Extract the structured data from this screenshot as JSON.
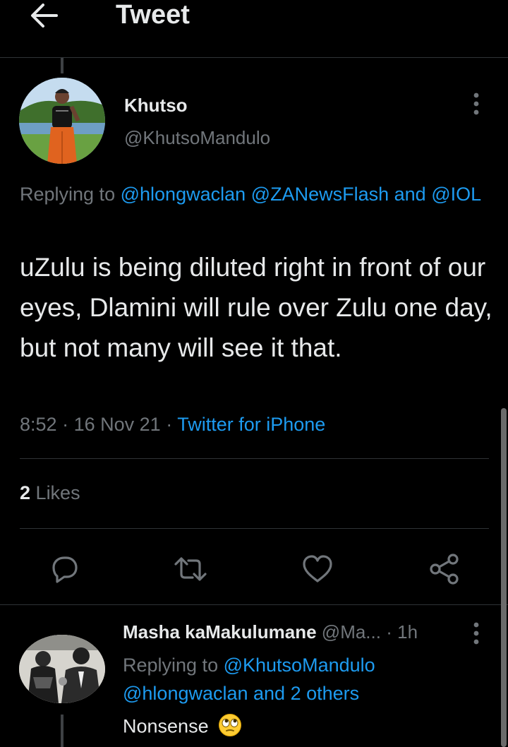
{
  "header": {
    "title": "Tweet",
    "back_icon": "arrow-left-icon"
  },
  "tweet": {
    "author_name": "Khutso",
    "author_handle": "@KhutsoMandulo",
    "replying_prefix": "Replying to",
    "replying_users": [
      "@hlongwaclan",
      "@ZANewsFlash"
    ],
    "replying_and": "and",
    "replying_last": "@IOL",
    "text": "uZulu is being diluted right in front of our eyes, Dlamini will rule over Zulu one day, but not many will see it that.",
    "time": "8:52",
    "date": "16 Nov 21",
    "dot": "·",
    "source": "Twitter for iPhone",
    "likes_count": "2",
    "likes_label": "Likes"
  },
  "actions": {
    "reply": "reply-icon",
    "retweet": "retweet-icon",
    "like": "heart-icon",
    "share": "share-icon"
  },
  "reply": {
    "name": "Masha kaMakulumane",
    "handle": "@Ma...",
    "time": "1h",
    "dot": "·",
    "replying_prefix": "Replying to",
    "replying_user": "@KhutsoMandulo",
    "replying_others": "@hlongwaclan and 2 others",
    "text": "Nonsense",
    "emoji": "face-with-rolling-eyes"
  },
  "colors": {
    "background": "#000000",
    "text": "#e7e9ea",
    "secondary": "#71767b",
    "link": "#1d9bf0",
    "divider": "#2f3336"
  }
}
